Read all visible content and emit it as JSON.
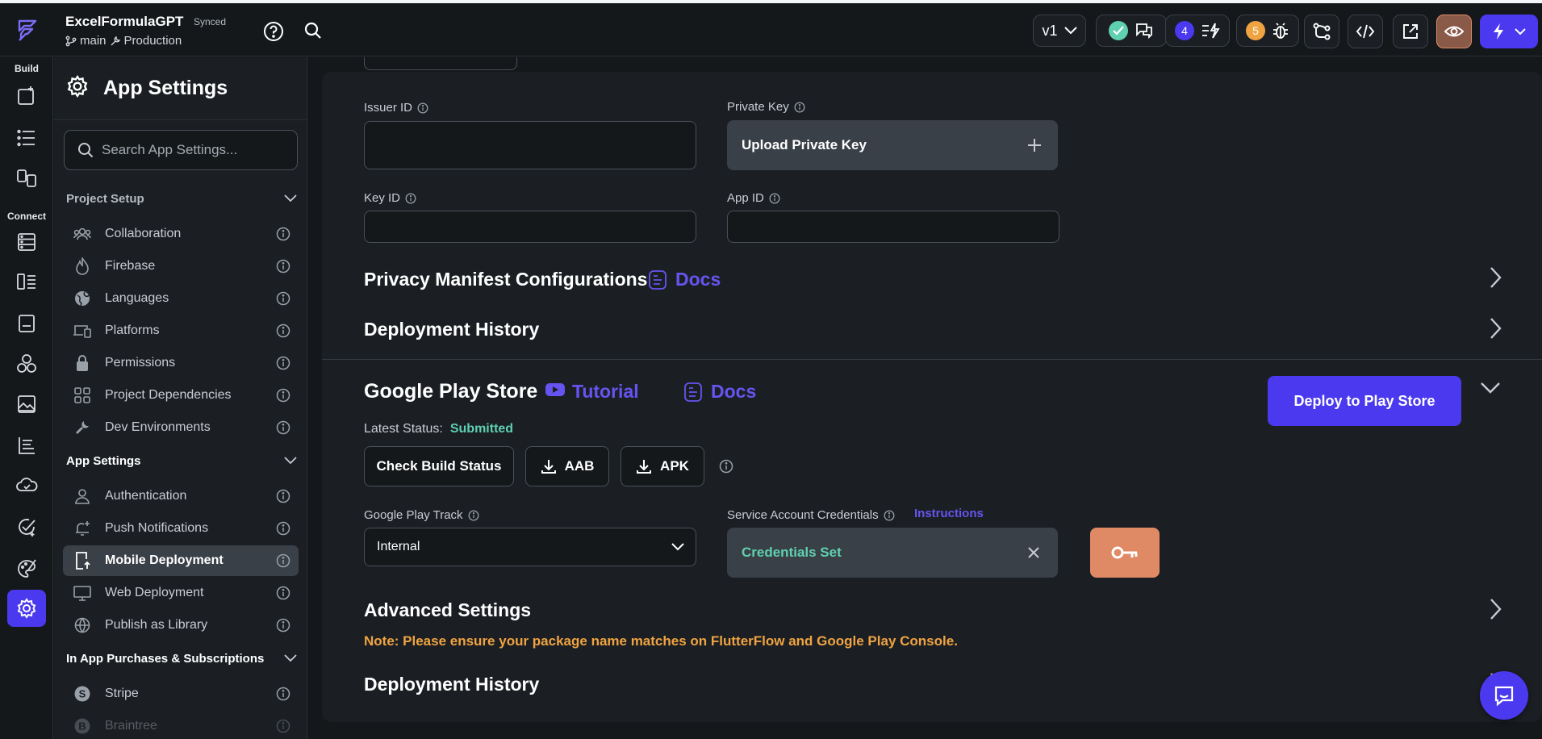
{
  "topbar": {
    "project_name": "ExcelFormulaGPT",
    "sync_status": "Synced",
    "branch": "main",
    "environment": "Production",
    "version": "v1",
    "badge_count_a": "4",
    "badge_count_b": "5"
  },
  "rail": {
    "build_label": "Build",
    "connect_label": "Connect"
  },
  "sidebar": {
    "title": "App Settings",
    "search_placeholder": "Search App Settings...",
    "sections": [
      {
        "label": "Project Setup",
        "items": [
          {
            "label": "Collaboration",
            "icon": "people-icon"
          },
          {
            "label": "Firebase",
            "icon": "flame-icon"
          },
          {
            "label": "Languages",
            "icon": "globe-icon"
          },
          {
            "label": "Platforms",
            "icon": "devices-icon"
          },
          {
            "label": "Permissions",
            "icon": "lock-icon"
          },
          {
            "label": "Project Dependencies",
            "icon": "grid-icon"
          },
          {
            "label": "Dev Environments",
            "icon": "wrench-icon"
          }
        ]
      },
      {
        "label": "App Settings",
        "items": [
          {
            "label": "Authentication",
            "icon": "person-icon"
          },
          {
            "label": "Push Notifications",
            "icon": "bell-icon"
          },
          {
            "label": "Mobile Deployment",
            "icon": "mobile-upload-icon",
            "active": true
          },
          {
            "label": "Web Deployment",
            "icon": "monitor-icon"
          },
          {
            "label": "Publish as Library",
            "icon": "globe-icon"
          }
        ]
      },
      {
        "label": "In App Purchases & Subscriptions",
        "items": [
          {
            "label": "Stripe",
            "icon": "stripe-icon"
          },
          {
            "label": "Braintree",
            "icon": "braintree-icon"
          }
        ]
      }
    ]
  },
  "apple": {
    "issuer_id_label": "Issuer ID",
    "private_key_label": "Private Key",
    "upload_private_key": "Upload Private Key",
    "key_id_label": "Key ID",
    "app_id_label": "App ID",
    "privacy_manifest_title": "Privacy Manifest Configurations",
    "docs_label": "Docs",
    "deployment_history_title": "Deployment History"
  },
  "google": {
    "title": "Google Play Store",
    "tutorial_label": "Tutorial",
    "docs_label": "Docs",
    "deploy_button": "Deploy to Play Store",
    "latest_status_label": "Latest Status:",
    "latest_status_value": "Submitted",
    "check_build_status": "Check Build Status",
    "aab_label": "AAB",
    "apk_label": "APK",
    "play_track_label": "Google Play Track",
    "play_track_value": "Internal",
    "service_account_label": "Service Account Credentials",
    "instructions_label": "Instructions",
    "credentials_value": "Credentials Set",
    "advanced_settings_title": "Advanced Settings",
    "note": "Note: Please ensure your package name matches on FlutterFlow and Google Play Console.",
    "deployment_history_title": "Deployment History"
  },
  "colors": {
    "accent": "#4b39ef",
    "success": "#5fd0b0",
    "warning": "#f0a341",
    "key_button": "#e08a65"
  }
}
